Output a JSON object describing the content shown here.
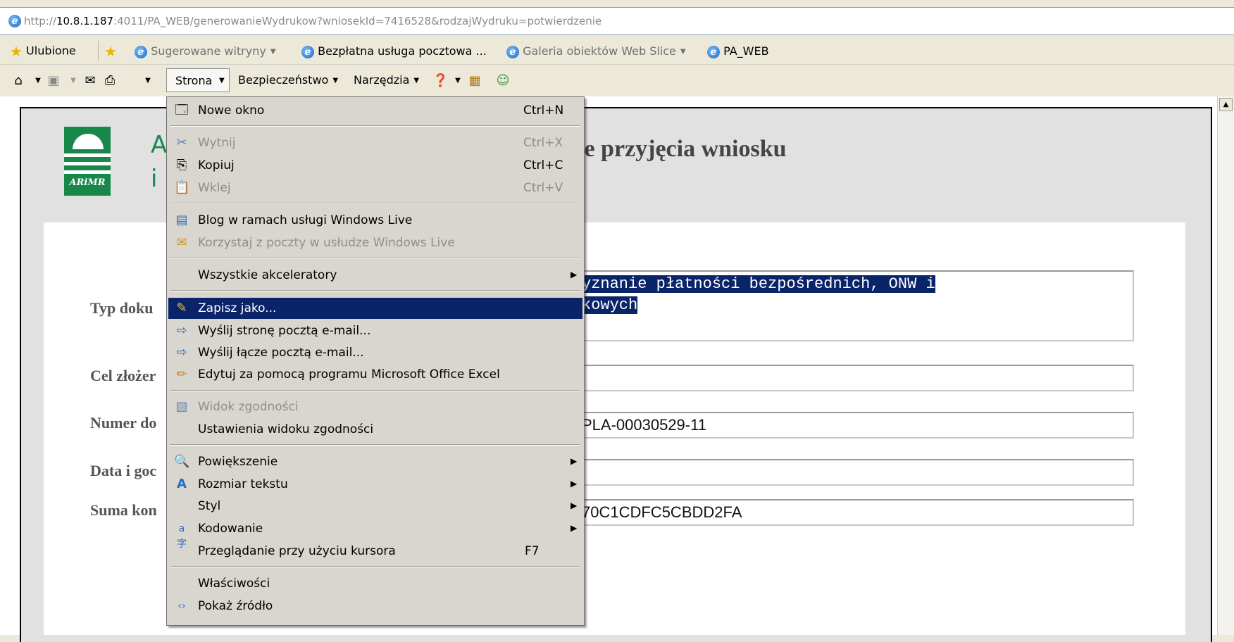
{
  "address_bar": {
    "url_prefix": "http://",
    "url_host": "10.8.1.187",
    "url_rest": ":4011/PA_WEB/generowanieWydrukow?wniosekId=7416528&rodzajWydruku=potwierdzenie"
  },
  "favorites_bar": {
    "favorites_label": "Ulubione",
    "links": [
      {
        "label": "Sugerowane witryny",
        "dropdown": true
      },
      {
        "label": "Bezpłatna usługa pocztowa ...",
        "dropdown": false
      },
      {
        "label": "Galeria obiektów Web Slice",
        "dropdown": true
      },
      {
        "label": "PA_WEB",
        "dropdown": false
      }
    ]
  },
  "command_bar": {
    "page_label": "Strona",
    "safety_label": "Bezpieczeństwo",
    "tools_label": "Narzędzia"
  },
  "page": {
    "org_line1": "A",
    "org_line2": "i",
    "logo_text": "ARiMR",
    "heading_fragment": "ie przyjęcia wniosku",
    "fields": [
      {
        "label": "Typ doku",
        "value_line1": "yznanie płatności bezpośrednich, ONW i",
        "value_line2": "kowych"
      },
      {
        "label": "Cel złożer",
        "value": ""
      },
      {
        "label": "Numer do",
        "value": "PLA-00030529-11"
      },
      {
        "label": "Data i goc",
        "value": ""
      },
      {
        "label": "Suma kon",
        "value": "70C1CDFC5CBDD2FA"
      }
    ]
  },
  "page_menu": {
    "items": [
      {
        "label": "Nowe okno",
        "shortcut": "Ctrl+N",
        "icon": "new-window-icon",
        "disabled": false
      },
      {
        "label": "Wytnij",
        "shortcut": "Ctrl+X",
        "icon": "scissors-icon",
        "disabled": true
      },
      {
        "label": "Kopiuj",
        "shortcut": "Ctrl+C",
        "icon": "copy-icon",
        "disabled": false
      },
      {
        "label": "Wklej",
        "shortcut": "Ctrl+V",
        "icon": "paste-icon",
        "disabled": true
      },
      {
        "label": "Blog w ramach usługi Windows Live",
        "shortcut": "",
        "icon": "blog-icon",
        "disabled": false
      },
      {
        "label": "Korzystaj z poczty w usłudze Windows Live",
        "shortcut": "",
        "icon": "mail-live-icon",
        "disabled": true
      },
      {
        "label": "Wszystkie akceleratory",
        "shortcut": "",
        "icon": "",
        "disabled": false,
        "submenu": true
      },
      {
        "label": "Zapisz jako...",
        "shortcut": "",
        "icon": "save-as-icon",
        "disabled": false,
        "selected": true
      },
      {
        "label": "Wyślij stronę pocztą e-mail...",
        "shortcut": "",
        "icon": "send-page-icon",
        "disabled": false
      },
      {
        "label": "Wyślij łącze pocztą e-mail...",
        "shortcut": "",
        "icon": "send-link-icon",
        "disabled": false
      },
      {
        "label": "Edytuj za pomocą programu Microsoft Office Excel",
        "shortcut": "",
        "icon": "edit-pencil-icon",
        "disabled": false
      },
      {
        "label": "Widok zgodności",
        "shortcut": "",
        "icon": "compatibility-view-icon",
        "disabled": true
      },
      {
        "label": "Ustawienia widoku zgodności",
        "shortcut": "",
        "icon": "",
        "disabled": false
      },
      {
        "label": "Powiększenie",
        "shortcut": "",
        "icon": "zoom-icon",
        "disabled": false,
        "submenu": true
      },
      {
        "label": "Rozmiar tekstu",
        "shortcut": "",
        "icon": "text-size-icon",
        "disabled": false,
        "submenu": true
      },
      {
        "label": "Styl",
        "shortcut": "",
        "icon": "",
        "disabled": false,
        "submenu": true
      },
      {
        "label": "Kodowanie",
        "shortcut": "",
        "icon": "encoding-icon",
        "disabled": false,
        "submenu": true
      },
      {
        "label": "Przeglądanie przy użyciu kursora",
        "shortcut": "F7",
        "icon": "",
        "disabled": false
      },
      {
        "label": "Właściwości",
        "shortcut": "",
        "icon": "",
        "disabled": false
      },
      {
        "label": "Pokaż źródło",
        "shortcut": "",
        "icon": "view-source-icon",
        "disabled": false
      }
    ]
  }
}
